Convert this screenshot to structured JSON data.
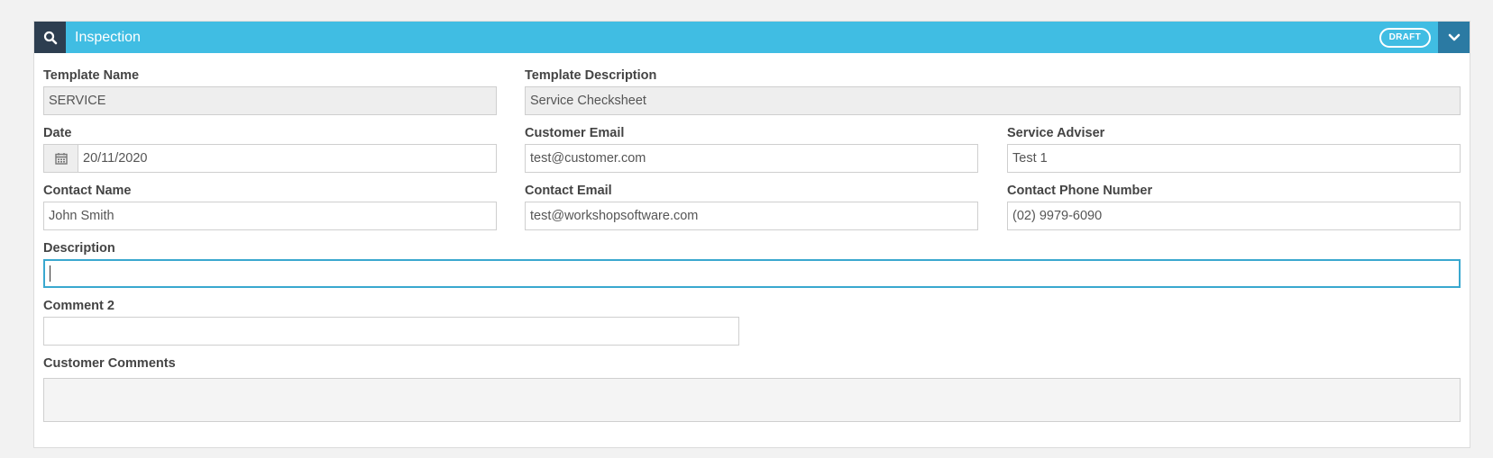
{
  "header": {
    "title": "Inspection",
    "badge": "DRAFT",
    "search_icon": "search-icon",
    "toggle_icon": "chevron-down-icon",
    "colors": {
      "bar": "#40bde3",
      "dark": "#2d3e50",
      "toggle": "#2b7aa3"
    }
  },
  "form": {
    "template_name": {
      "label": "Template Name",
      "value": "SERVICE"
    },
    "template_description": {
      "label": "Template Description",
      "value": "Service Checksheet"
    },
    "date": {
      "label": "Date",
      "value": "20/11/2020",
      "icon": "calendar-icon"
    },
    "customer_email": {
      "label": "Customer Email",
      "value": "test@customer.com"
    },
    "service_adviser": {
      "label": "Service Adviser",
      "value": "Test 1"
    },
    "contact_name": {
      "label": "Contact Name",
      "value": "John Smith"
    },
    "contact_email": {
      "label": "Contact Email",
      "value": "test@workshopsoftware.com"
    },
    "contact_phone": {
      "label": "Contact Phone Number",
      "value": "(02) 9979-6090"
    },
    "description": {
      "label": "Description",
      "value": ""
    },
    "comment2": {
      "label": "Comment 2",
      "value": ""
    },
    "customer_comments": {
      "label": "Customer Comments",
      "value": ""
    }
  }
}
